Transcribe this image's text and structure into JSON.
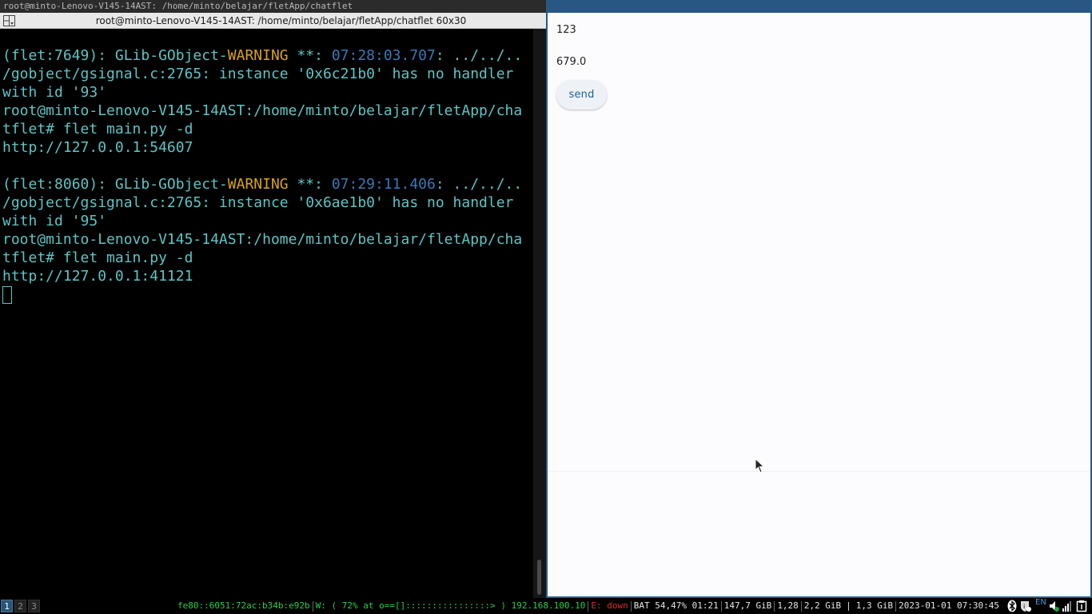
{
  "left_window": {
    "outer_title": "root@minto-Lenovo-V145-14AST: /home/minto/belajar/fletApp/chatflet",
    "terminal_title": "root@minto-Lenovo-V145-14AST: /home/minto/belajar/fletApp/chatflet 60x30",
    "lines": [
      {
        "segments": [
          {
            "text": "(flet:7649): GLib-GObject-",
            "color": "cyan"
          },
          {
            "text": "WARNING",
            "color": "yellow"
          },
          {
            "text": " **: ",
            "color": "cyan"
          },
          {
            "text": "07:28:03.707",
            "color": "blue"
          },
          {
            "text": ": ../../..",
            "color": "cyan"
          }
        ]
      },
      {
        "segments": [
          {
            "text": "/gobject/gsignal.c:2765: instance '0x6c21b0' has no handler",
            "color": "cyan"
          }
        ]
      },
      {
        "segments": [
          {
            "text": "with id '93'",
            "color": "cyan"
          }
        ]
      },
      {
        "segments": [
          {
            "text": "root@minto-Lenovo-V145-14AST:/home/minto/belajar/fletApp/cha",
            "color": "cyan"
          }
        ]
      },
      {
        "segments": [
          {
            "text": "tflet# flet main.py -d",
            "color": "cyan"
          }
        ]
      },
      {
        "segments": [
          {
            "text": "http://127.0.0.1:54607",
            "color": "cyan"
          }
        ]
      },
      {
        "segments": [
          {
            "text": "",
            "color": "cyan"
          }
        ]
      },
      {
        "segments": [
          {
            "text": "(flet:8060): GLib-GObject-",
            "color": "cyan"
          },
          {
            "text": "WARNING",
            "color": "yellow"
          },
          {
            "text": " **: ",
            "color": "cyan"
          },
          {
            "text": "07:29:11.406",
            "color": "blue"
          },
          {
            "text": ": ../../..",
            "color": "cyan"
          }
        ]
      },
      {
        "segments": [
          {
            "text": "/gobject/gsignal.c:2765: instance '0x6ae1b0' has no handler",
            "color": "cyan"
          }
        ]
      },
      {
        "segments": [
          {
            "text": "with id '95'",
            "color": "cyan"
          }
        ]
      },
      {
        "segments": [
          {
            "text": "root@minto-Lenovo-V145-14AST:/home/minto/belajar/fletApp/cha",
            "color": "cyan"
          }
        ]
      },
      {
        "segments": [
          {
            "text": "tflet# flet main.py -d",
            "color": "cyan"
          }
        ]
      },
      {
        "segments": [
          {
            "text": "http://127.0.0.1:41121",
            "color": "cyan"
          }
        ]
      }
    ]
  },
  "right_window": {
    "value_1": "123",
    "value_2": "679.0",
    "send_label": "send"
  },
  "statusbar": {
    "workspaces": [
      "1",
      "2",
      "3"
    ],
    "active_workspace": "1",
    "ipv6": "fe80::6051:72ac:b34b:e92b",
    "wifi": "W: ( 72% at o==[]::::::::::::::::> ) 192.168.100.10",
    "ethernet": "E: down",
    "battery": "BAT 54,47% 01:21",
    "disk": "147,7 GiB",
    "load": "1,28",
    "memory_used": "2,2 GiB",
    "memory_avail": "1,3 GiB",
    "datetime": "2023-01-01 07:30:45",
    "keyboard_layout": "EN"
  },
  "colors": {
    "terminal_cyan": "#5fc4c4",
    "terminal_yellow": "#d9a21f",
    "terminal_blue": "#3a78b8",
    "focused_border": "#285783",
    "button_text": "#1f5f8e",
    "status_green": "#22d04d",
    "status_red": "#e22a2a"
  }
}
